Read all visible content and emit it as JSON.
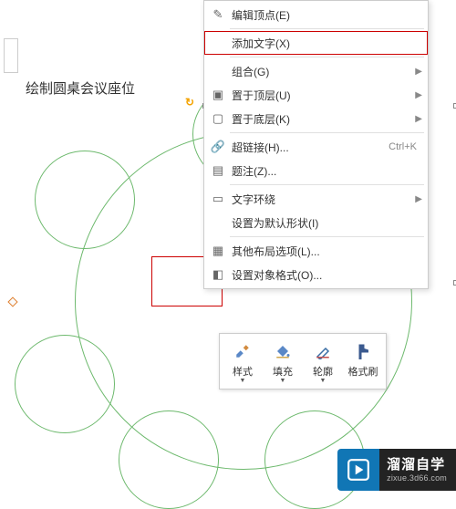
{
  "canvas": {
    "title": "绘制圆桌会议座位"
  },
  "menu": {
    "items": [
      {
        "icon": "✎",
        "label": "编辑顶点(E)"
      },
      {
        "icon": "",
        "label": "添加文字(X)",
        "highlighted": true
      },
      {
        "icon": "",
        "label": "组合(G)",
        "arrow": true
      },
      {
        "icon": "▣",
        "label": "置于顶层(U)",
        "arrow": true
      },
      {
        "icon": "▢",
        "label": "置于底层(K)",
        "arrow": true
      },
      {
        "icon": "🔗",
        "label": "超链接(H)...",
        "shortcut": "Ctrl+K"
      },
      {
        "icon": "▤",
        "label": "题注(Z)..."
      },
      {
        "icon": "▭",
        "label": "文字环绕",
        "arrow": true
      },
      {
        "icon": "",
        "label": "设置为默认形状(I)"
      },
      {
        "icon": "▦",
        "label": "其他布局选项(L)..."
      },
      {
        "icon": "◧",
        "label": "设置对象格式(O)..."
      }
    ]
  },
  "toolbar": {
    "style": "样式",
    "fill": "填充",
    "outline": "轮廓",
    "format_painter": "格式刷"
  },
  "watermark": {
    "title": "溜溜自学",
    "sub": "zixue.3d66.com"
  }
}
